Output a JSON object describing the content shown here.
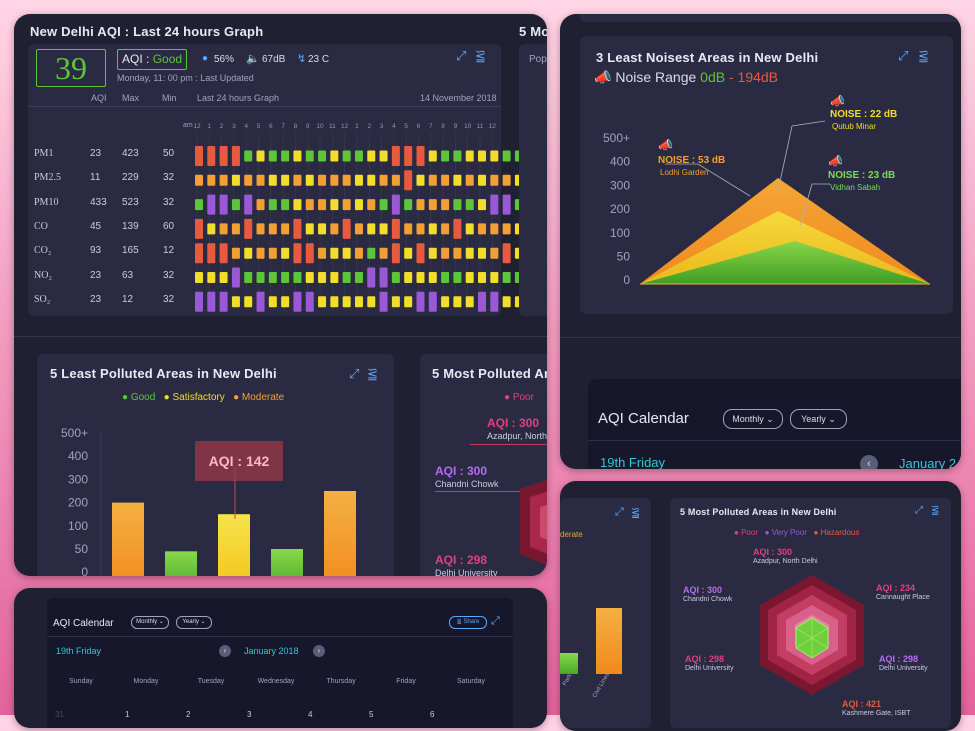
{
  "card1": {
    "title": "New Delhi AQI : Last 24 hours Graph",
    "next_title": "5 Mo",
    "next_sub": "Pop",
    "aqi_value": "39",
    "aqi_label": "AQI : ",
    "aqi_status": "Good",
    "humidity": "56%",
    "noise": "67dB",
    "temp": "23 C",
    "updated": "Monday, 11: 00 pm : Last Updated",
    "headers": {
      "aqi": "AQI",
      "max": "Max",
      "min": "Min",
      "graph": "Last 24 hours Graph",
      "date": "14 November 2018"
    },
    "hours_prefix": "am",
    "hours": [
      "12",
      "1",
      "2",
      "3",
      "4",
      "5",
      "6",
      "7",
      "8",
      "9",
      "10",
      "11",
      "12",
      "1",
      "2",
      "3",
      "4",
      "5",
      "6",
      "7",
      "8",
      "9",
      "10",
      "11",
      "12"
    ],
    "rows": [
      {
        "name": "PM1",
        "aqi": "23",
        "max": "423",
        "min": "50"
      },
      {
        "name": "PM2.5",
        "aqi": "11",
        "max": "229",
        "min": "32"
      },
      {
        "name": "PM10",
        "aqi": "433",
        "max": "523",
        "min": "32"
      },
      {
        "name": "CO",
        "aqi": "45",
        "max": "139",
        "min": "60"
      },
      {
        "name": "CO₂",
        "aqi": "93",
        "max": "165",
        "min": "12"
      },
      {
        "name": "NO₂",
        "aqi": "23",
        "max": "63",
        "min": "32"
      },
      {
        "name": "SO₂",
        "aqi": "23",
        "max": "12",
        "min": "32"
      }
    ],
    "heat_codes": [
      "rrrrgyggyggyggyyrrryggyyygg",
      "oooyooyyoyoooyyooryooyoyooy",
      "gppgpoggyooyoyogpgoooggyppg",
      "ryooroooryyoroyyrooyoryoooy",
      "rrroyooyrroyyogoryryooyyory",
      "yyypgggggyyyggppgyyyggyyygg",
      "pppyypyyppyyyyypyyppyyyppyy"
    ],
    "colors": {
      "r": "#e85a3d",
      "o": "#f2a033",
      "y": "#f2dc2c",
      "g": "#5cc638",
      "p": "#9a58d6"
    }
  },
  "card2": {
    "title": "3 Least Noisest Areas in New Delhi",
    "range_label": "Noise Range ",
    "range_min": "0dB",
    "range_sep": " - ",
    "range_max": "194dB",
    "yticks": [
      "500+",
      "400",
      "300",
      "200",
      "100",
      "50",
      "0"
    ],
    "callouts": [
      {
        "noise": "NOISE : 22 dB",
        "place": "Qutub Minar",
        "color": "#f2dc2c"
      },
      {
        "noise": "NOISE : 53 dB",
        "place": "Lodhi Garden",
        "color": "#f2a033"
      },
      {
        "noise": "NOISE : 23 dB",
        "place": "Vidhan Sabah",
        "color": "#7ed957"
      }
    ],
    "calendar_title": "AQI Calendar",
    "monthly": "Monthly",
    "yearly": "Yearly",
    "day_label": "19th  Friday",
    "month_label": "January 2"
  },
  "card3": {
    "title": "5 Least Polluted Areas in New Delhi",
    "legend": [
      {
        "label": "Good",
        "color": "#5cc638"
      },
      {
        "label": "Satisfactory",
        "color": "#f2dc2c"
      },
      {
        "label": "Moderate",
        "color": "#f2a033"
      }
    ],
    "yticks": [
      "500+",
      "400",
      "300",
      "200",
      "100",
      "50",
      "0"
    ],
    "chart_data": {
      "type": "bar",
      "values": [
        200,
        45,
        150,
        50,
        250
      ],
      "ylim": [
        0,
        500
      ]
    },
    "tooltip": "AQI : 142",
    "right_title": "5 Most Polluted Are",
    "right_legend": "Poor",
    "right_labels": [
      {
        "aqi": "AQI : 300",
        "place": "Azadpur, North"
      },
      {
        "aqi": "AQI : 300",
        "place": "Chandni Chowk"
      },
      {
        "aqi": "AQI : 298",
        "place": "Delhi University"
      }
    ]
  },
  "card4": {
    "title": "AQI Calendar",
    "monthly": "Monthly",
    "yearly": "Yearly",
    "share": "Share",
    "day_label": "19th  Friday",
    "month": "January 2018",
    "weekdays": [
      "Sunday",
      "Monday",
      "Tuesday",
      "Wednesday",
      "Thursday",
      "Friday",
      "Saturday"
    ],
    "dates": [
      "31",
      "1",
      "2",
      "3",
      "4",
      "5",
      "6"
    ]
  },
  "card5": {
    "left_legend": "derate",
    "left_xlabels": [
      "Park",
      "Civil Lines"
    ],
    "title": "5 Most Polluted Areas in New Delhi",
    "legend": [
      {
        "label": "Poor",
        "color": "#e0417e"
      },
      {
        "label": "Very Poor",
        "color": "#9a58d6"
      },
      {
        "label": "Hazardous",
        "color": "#e85a3d"
      }
    ],
    "labels": [
      {
        "aqi": "AQI : 300",
        "place": "Azadpur, North Delhi",
        "color": "#e0417e"
      },
      {
        "aqi": "AQI : 234",
        "place": "Cannaught Place",
        "color": "#e0417e"
      },
      {
        "aqi": "AQI : 300",
        "place": "Chandni Chowk",
        "color": "#b56cf0"
      },
      {
        "aqi": "AQI : 298",
        "place": "Delhi University",
        "color": "#e0417e"
      },
      {
        "aqi": "AQI : 298",
        "place": "Delhi University",
        "color": "#b56cf0"
      },
      {
        "aqi": "AQI : 421",
        "place": "Kashmere Gate, ISBT",
        "color": "#e85a3d"
      }
    ]
  }
}
